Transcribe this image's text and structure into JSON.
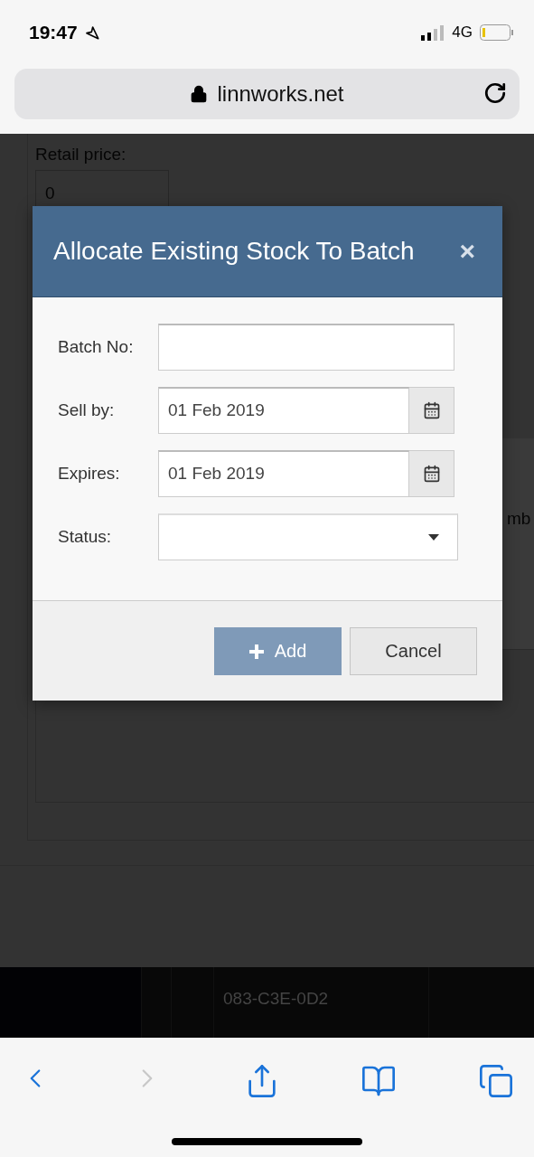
{
  "status_bar": {
    "time": "19:47",
    "network": "4G"
  },
  "browser": {
    "url": "linnworks.net"
  },
  "background": {
    "retail_price_label": "Retail price:",
    "retail_price_value": "0",
    "column_fragment": "mb",
    "table_cell": "083-C3E-0D2"
  },
  "dialog": {
    "title": "Allocate Existing Stock To Batch",
    "close": "×",
    "fields": [
      {
        "kind": "text",
        "label": "Batch No:"
      },
      {
        "kind": "date",
        "label": "Sell by:",
        "value": "01 Feb 2019"
      },
      {
        "kind": "date",
        "label": "Expires:",
        "value": "01 Feb 2019"
      },
      {
        "kind": "select",
        "label": "Status:"
      }
    ],
    "buttons": [
      {
        "kind": "primary",
        "label": "Add"
      },
      {
        "kind": "secondary",
        "label": "Cancel"
      }
    ]
  },
  "toolbar": [
    {
      "kind": "back",
      "disabled": false
    },
    {
      "kind": "forward",
      "disabled": true
    },
    {
      "kind": "share",
      "disabled": false
    },
    {
      "kind": "bookmarks",
      "disabled": false
    },
    {
      "kind": "tabs",
      "disabled": false
    }
  ]
}
